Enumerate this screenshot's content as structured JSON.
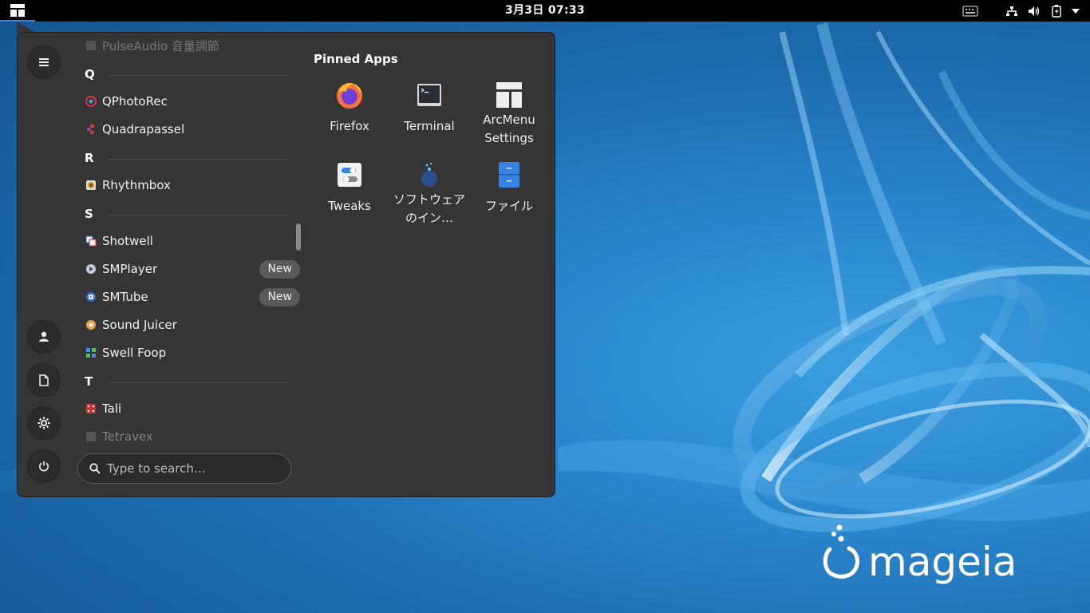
{
  "topbar": {
    "clock": "3月3日  07:33"
  },
  "menu": {
    "partial_top_item": "PulseAudio 音量調節",
    "sections": [
      {
        "letter": "Q",
        "items": [
          {
            "label": "QPhotoRec",
            "badge": ""
          },
          {
            "label": "Quadrapassel",
            "badge": ""
          }
        ]
      },
      {
        "letter": "R",
        "items": [
          {
            "label": "Rhythmbox",
            "badge": ""
          }
        ]
      },
      {
        "letter": "S",
        "items": [
          {
            "label": "Shotwell",
            "badge": ""
          },
          {
            "label": "SMPlayer",
            "badge": "New"
          },
          {
            "label": "SMTube",
            "badge": "New"
          },
          {
            "label": "Sound Juicer",
            "badge": ""
          },
          {
            "label": "Swell Foop",
            "badge": ""
          }
        ]
      },
      {
        "letter": "T",
        "items": [
          {
            "label": "Tali",
            "badge": ""
          },
          {
            "label": "Tetravex",
            "badge": ""
          }
        ]
      }
    ],
    "search_placeholder": "Type to search…",
    "pinned_title": "Pinned Apps",
    "pinned": [
      {
        "label": "Firefox"
      },
      {
        "label": "Terminal"
      },
      {
        "label": "ArcMenu Settings"
      },
      {
        "label": "Tweaks"
      },
      {
        "label": "ソフトウェアのイン…"
      },
      {
        "label": "ファイル"
      }
    ]
  },
  "wallpaper": {
    "logo_text": "mageia"
  },
  "colors": {
    "accent": "#3584e4",
    "menu_bg": "#353535",
    "topbar_bg": "#000000"
  }
}
